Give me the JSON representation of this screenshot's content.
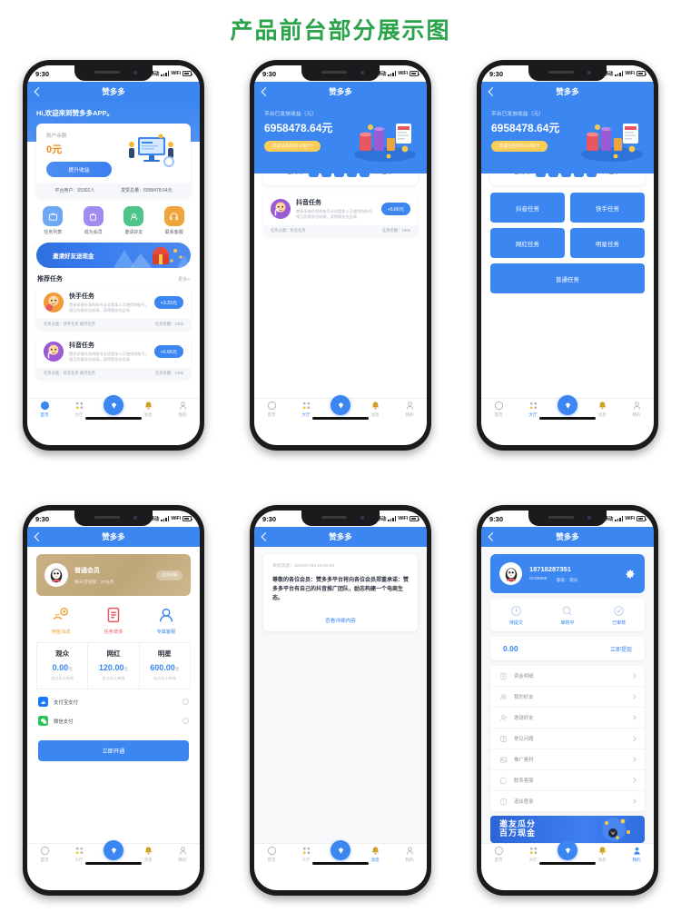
{
  "page": {
    "title": "产品前台部分展示图",
    "title_color": "#2aa34a"
  },
  "common": {
    "status_time": "9:30",
    "carrier": "中国移动",
    "wifi_label": "WiFi",
    "app_title": "赞多多",
    "back_icon": "chevron-left-icon",
    "tabbar": [
      {
        "label": "首页",
        "icon": "home-icon"
      },
      {
        "label": "大厅",
        "icon": "grid-icon"
      },
      {
        "label": "",
        "icon": "diamond-icon"
      },
      {
        "label": "消息",
        "icon": "bell-icon"
      },
      {
        "label": "我的",
        "icon": "person-icon"
      }
    ],
    "accent": "#3b86f0",
    "gold": "#f08a1e"
  },
  "screen1": {
    "greeting": "Hi,欢迎来到赞多多APP。",
    "balance_label": "账户余额",
    "balance_value": "0元",
    "balance_button": "提升收益",
    "stats": [
      {
        "label": "平台用户：",
        "value": "55302人"
      },
      {
        "label": "发赞总量：",
        "value": "6958478.64元"
      }
    ],
    "quick_actions": [
      {
        "label": "任务列表",
        "icon": "briefcase-icon",
        "color": "#6ea8f5"
      },
      {
        "label": "成为会员",
        "icon": "bag-icon",
        "color": "#a08bf0"
      },
      {
        "label": "邀请好友",
        "icon": "share-icon",
        "color": "#4fc48a"
      },
      {
        "label": "联系客服",
        "icon": "headset-icon",
        "color": "#f0a53c"
      }
    ],
    "banner_text": "邀请好友送现金",
    "section_title": "推荐任务",
    "section_more": "更多>",
    "tasks": [
      {
        "name": "快手任务",
        "desc": "赞多多做任务的账号必须是本人可使用的账号，相互的要求比较高，获得佣金也会高",
        "price": "+3.33元",
        "meta_left": "任务分类：快手任务  视点任务",
        "meta_right": "任务名额：1000",
        "avatar_color": "#f2993c"
      },
      {
        "name": "抖音任务",
        "desc": "赞多多做任务的账号必须是本人可使用的账号，相互的要求比较高，获得佣金也会高",
        "price": "+6.66元",
        "meta_left": "任务分类：抖音任务  视点任务",
        "meta_right": "任务名额：1000",
        "avatar_color": "#9b5bd6"
      }
    ]
  },
  "screen2": {
    "hero_label": "平台已发放收益（元）",
    "hero_amount": "6958478.64元",
    "hero_badge": "完成任务时间 40秒/个",
    "count_label": "已完成",
    "count_digits": [
      "1",
      "3",
      "8",
      "7",
      "9"
    ],
    "count_suffix": "件任务",
    "task": {
      "name": "抖音任务",
      "desc": "赞多多做任务的账号必须是本人可使用的账号，相互的要求比较高，获得佣金也会高",
      "price": "+6.66元",
      "meta_left": "任务分类：抖音任务",
      "meta_right": "任务名额：1000",
      "avatar_color": "#9b5bd6"
    }
  },
  "screen3": {
    "hero_label": "平台已发放收益（元）",
    "hero_amount": "6958478.64元",
    "hero_badge": "完成任务时间 40秒/个",
    "count_label": "已完成",
    "count_digits": [
      "1",
      "3",
      "8",
      "7",
      "9"
    ],
    "count_suffix": "件任务",
    "buttons": [
      "抖音任务",
      "快手任务",
      "网红任务",
      "明星任务",
      "普通任务"
    ]
  },
  "screen4": {
    "vip_title": "普通会员",
    "vip_sub": "每天可领取：20任务",
    "vip_tag": "会员详情",
    "perks": [
      {
        "label": "佣金加成",
        "icon": "coin-hand-icon",
        "color": "#f0a53c"
      },
      {
        "label": "任务增多",
        "icon": "document-icon",
        "color": "#e8575f"
      },
      {
        "label": "专属客服",
        "icon": "support-icon",
        "color": "#3b86f0"
      }
    ],
    "tiers": [
      {
        "name": "观众",
        "price": "0.00",
        "unit": "元",
        "desc": "自点永久有效"
      },
      {
        "name": "网红",
        "price": "120.00",
        "unit": "元",
        "desc": "自点永久有效"
      },
      {
        "name": "明星",
        "price": "600.00",
        "unit": "元",
        "desc": "自点永久有效"
      }
    ],
    "payments": [
      {
        "label": "支付宝支付",
        "icon": "alipay-icon",
        "color": "#1677ff"
      },
      {
        "label": "微信支付",
        "icon": "wechat-icon",
        "color": "#2ec25b"
      }
    ],
    "submit_button": "立即开通"
  },
  "screen5": {
    "meta_label": "系统消息：",
    "meta_time": "2019/07/23 16:30:58",
    "body": "尊敬的各位会员：赞多多平台将向各位会员郑重承诺：赞多多平台有自己的抖音推广团队，励志构建一个电商生态。",
    "link": "查看详细内容"
  },
  "screen6": {
    "phone": "18718287351",
    "user_id": "ID:66888",
    "level": "等级：观众",
    "settings_icon": "gear-icon",
    "segments": [
      {
        "label": "待提交",
        "icon": "clock-icon"
      },
      {
        "label": "审核中",
        "icon": "review-icon"
      },
      {
        "label": "已审核",
        "icon": "check-icon"
      }
    ],
    "wallet_amount": "0.00",
    "wallet_action": "立即提现",
    "menu": [
      {
        "label": "资金明细",
        "icon": "money-list-icon"
      },
      {
        "label": "我的好友",
        "icon": "friends-icon"
      },
      {
        "label": "邀请好友",
        "icon": "invite-icon"
      },
      {
        "label": "常见问题",
        "icon": "faq-icon"
      },
      {
        "label": "推广素材",
        "icon": "media-icon"
      },
      {
        "label": "联系客服",
        "icon": "service-icon"
      },
      {
        "label": "退出登录",
        "icon": "logout-icon"
      }
    ],
    "promo_line1": "邀友瓜分",
    "promo_line2": "百万现金"
  }
}
